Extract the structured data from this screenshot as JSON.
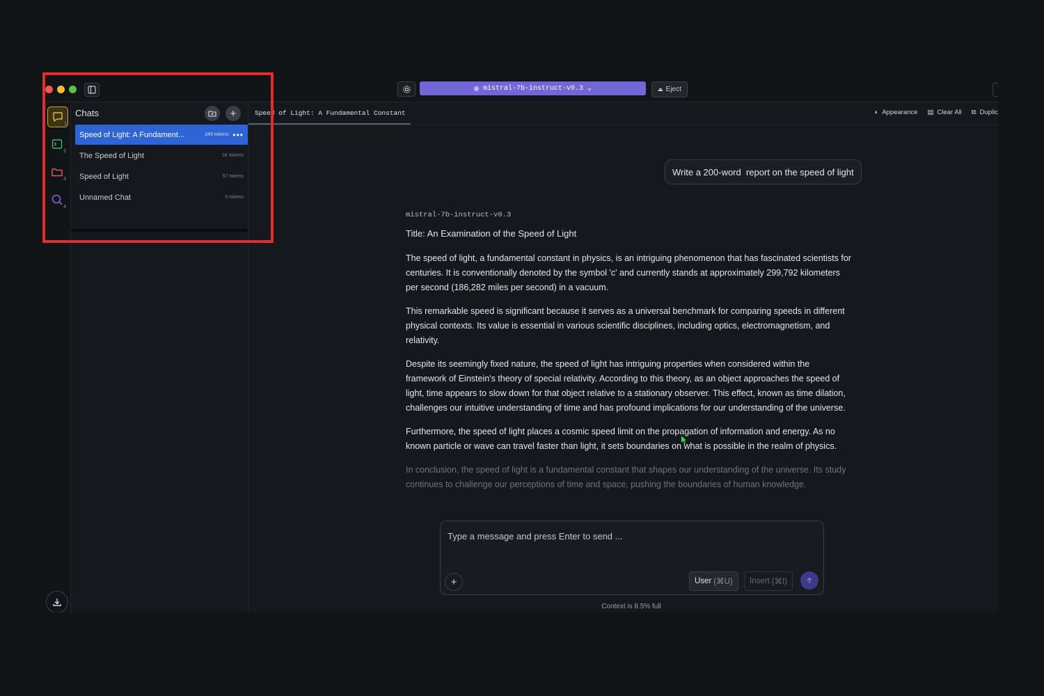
{
  "titlebar": {
    "model_name": "mistral-7b-instruct-v0.3",
    "eject_label": "Eject"
  },
  "rail": {
    "items": [
      {
        "icon": "chat-bubble-icon",
        "number": "1",
        "active": true
      },
      {
        "icon": "terminal-icon",
        "number": "2"
      },
      {
        "icon": "folder-icon",
        "number": "3"
      },
      {
        "icon": "search-icon",
        "number": "4"
      }
    ]
  },
  "chats": {
    "title": "Chats",
    "items": [
      {
        "label": "Speed of Light: A Fundament...",
        "tokens": "349 tokens",
        "active": true
      },
      {
        "label": "The Speed of Light",
        "tokens": "1K tokens"
      },
      {
        "label": "Speed of Light",
        "tokens": "57 tokens"
      },
      {
        "label": "Unnamed Chat",
        "tokens": "0 tokens"
      }
    ]
  },
  "main": {
    "tab_label": "Speed of Light: A Fundamental Constant",
    "actions": {
      "appearance": "Appearance",
      "clear_all": "Clear All",
      "duplicate": "Duplic"
    },
    "user_message": "Write a 200-word  report on the speed of light",
    "assistant": {
      "model_name": "mistral-7b-instruct-v0.3",
      "title": "Title: An Examination of the Speed of Light",
      "paragraphs": [
        "The speed of light, a fundamental constant in physics, is an intriguing phenomenon that has fascinated scientists for centuries. It is conventionally denoted by the symbol 'c' and currently stands at approximately 299,792 kilometers per second (186,282 miles per second) in a vacuum.",
        "This remarkable speed is significant because it serves as a universal benchmark for comparing speeds in different physical contexts. Its value is essential in various scientific disciplines, including optics, electromagnetism, and relativity.",
        "Despite its seemingly fixed nature, the speed of light has intriguing properties when considered within the framework of Einstein's theory of special relativity. According to this theory, as an object approaches the speed of light, time appears to slow down for that object relative to a stationary observer. This effect, known as time dilation, challenges our intuitive understanding of time and has profound implications for our understanding of the universe.",
        "Furthermore, the speed of light places a cosmic speed limit on the propagation of information and energy. As no known particle or wave can travel faster than light, it sets boundaries on what is possible in the realm of physics.",
        "In conclusion, the speed of light is a fundamental constant that shapes our understanding of the universe. Its study continues to challenge our perceptions of time and space, pushing the boundaries of human knowledge."
      ]
    },
    "composer": {
      "placeholder": "Type a message and press Enter to send ...",
      "user_label": "User",
      "user_hotkey": "(⌘U)",
      "insert_label": "Insert",
      "insert_hotkey": "(⌘I)"
    },
    "context_note": "Context is 8.5% full"
  },
  "colors": {
    "accent": "#7266d8",
    "active_chat": "#2f64d6",
    "highlight_box": "#e52b2b"
  }
}
